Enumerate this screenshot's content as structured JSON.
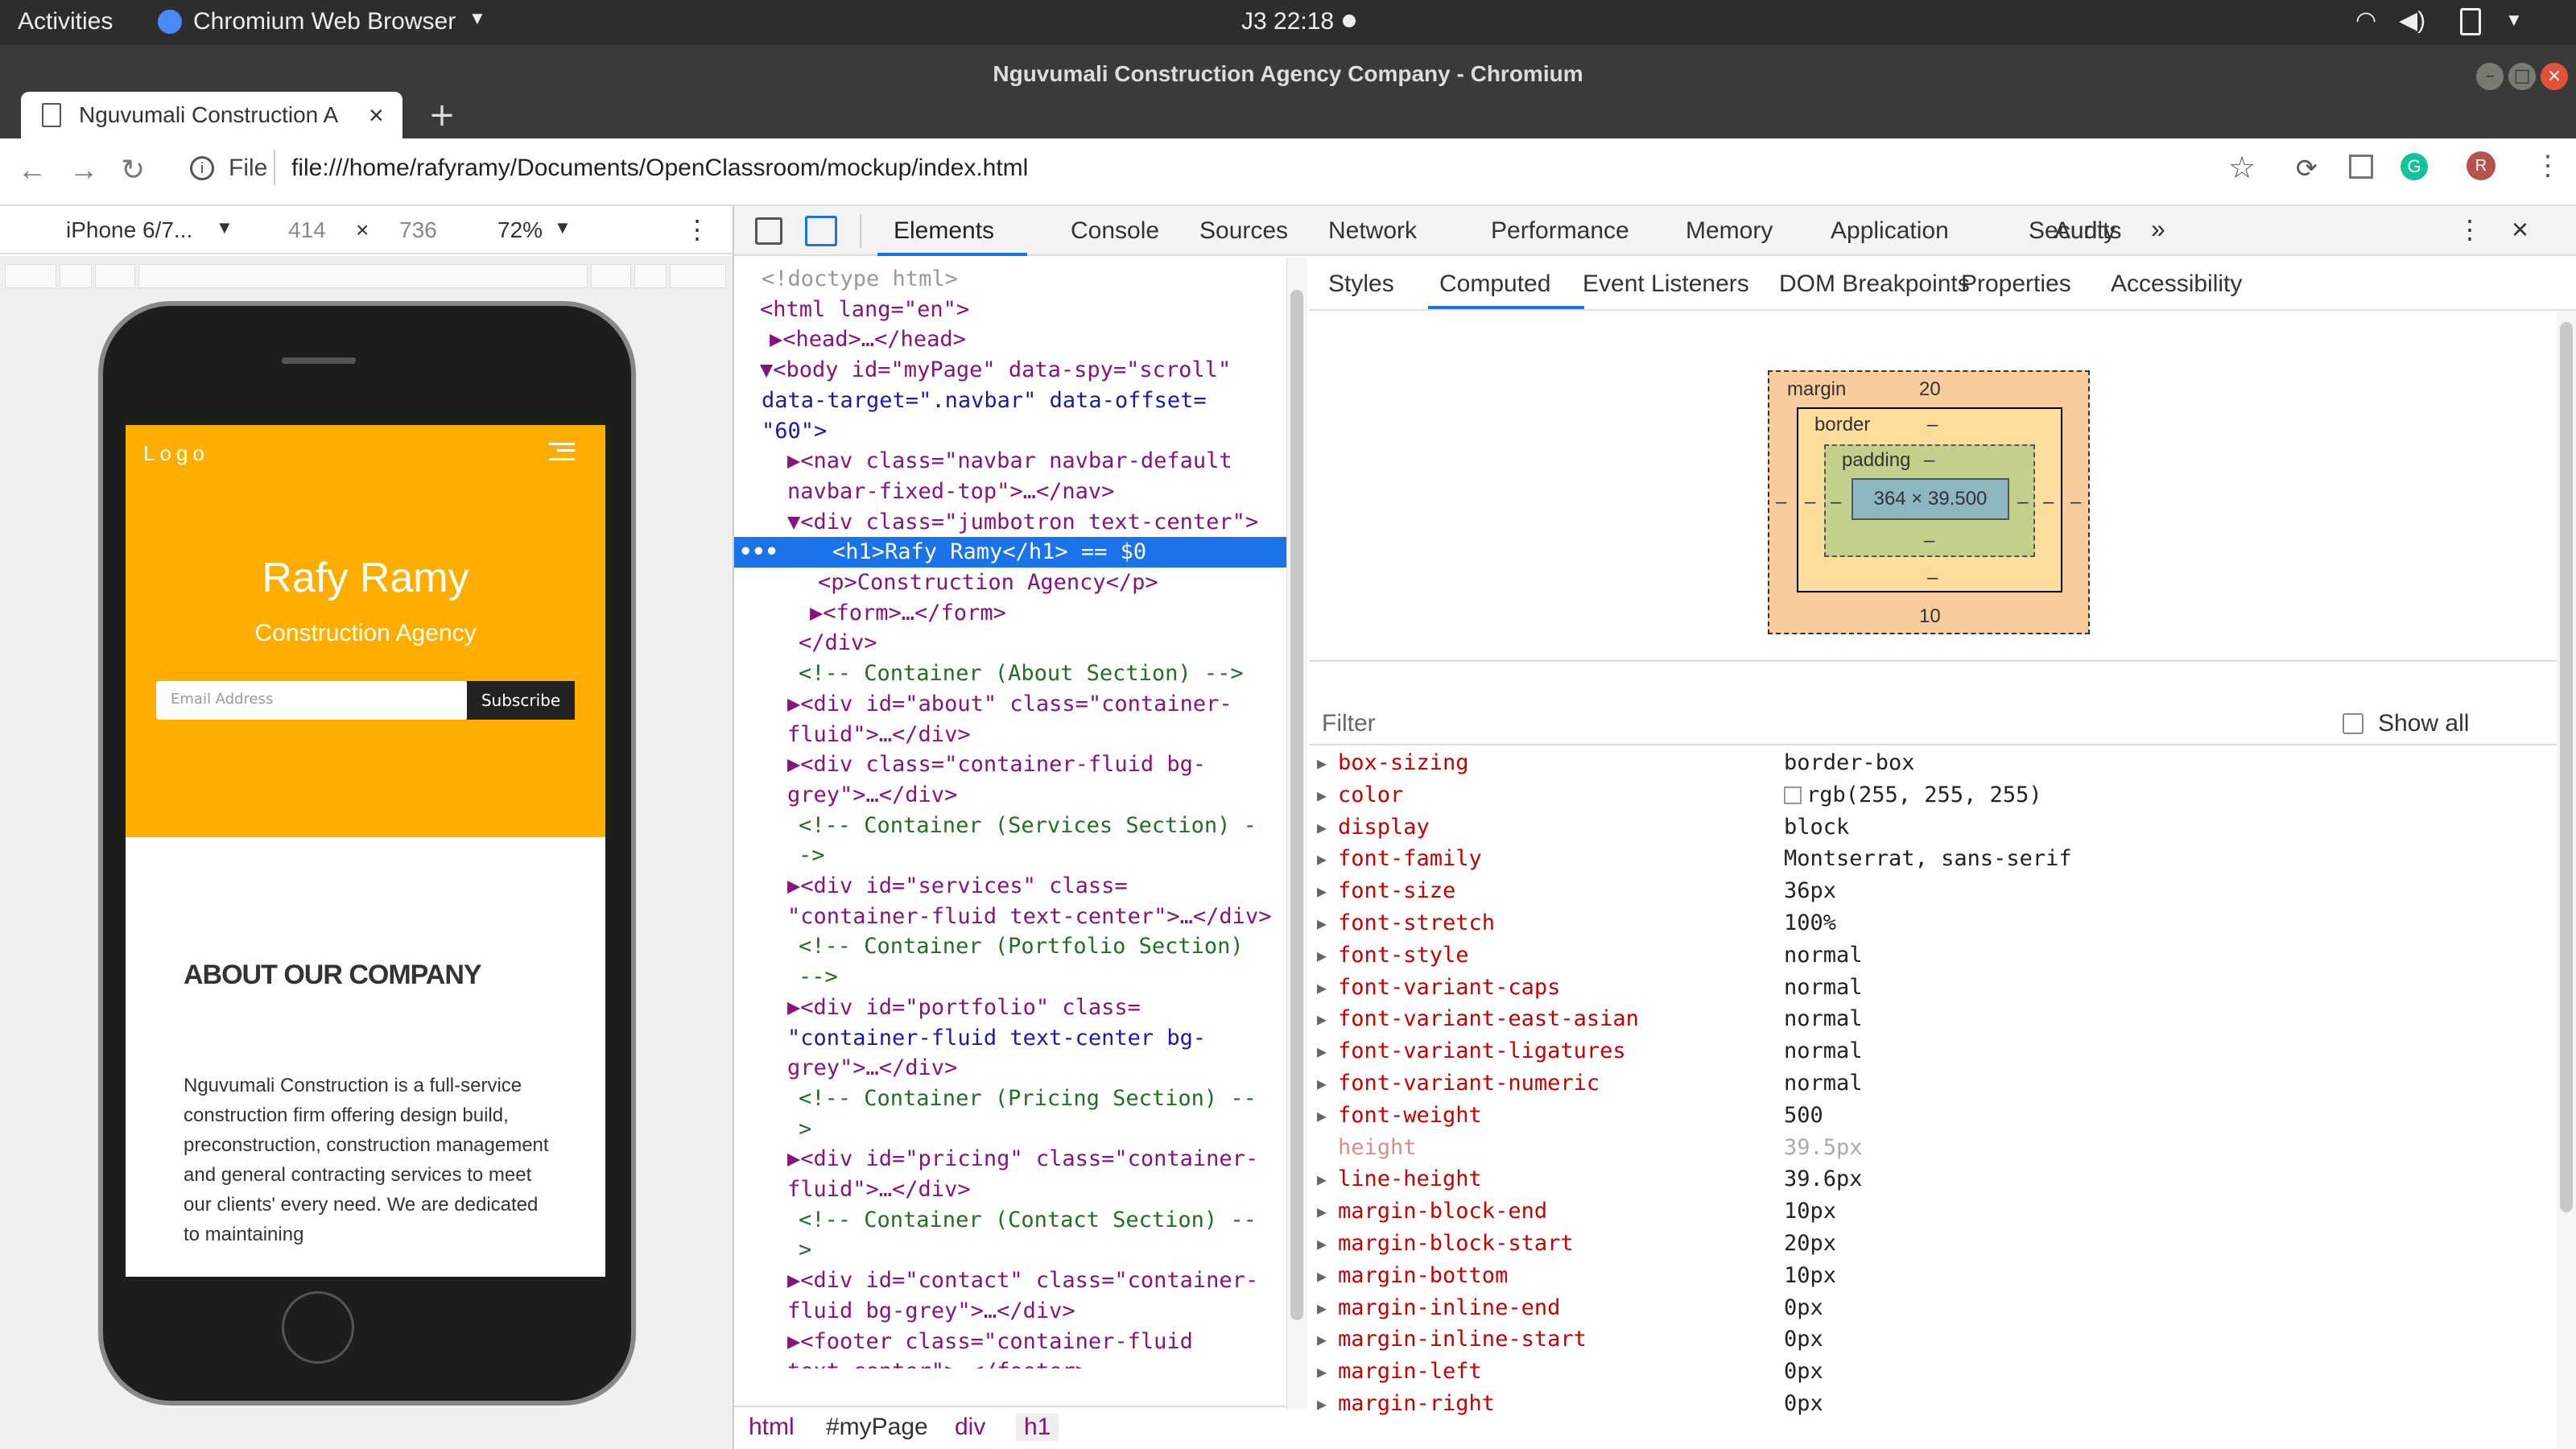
{
  "topbar": {
    "activities": "Activities",
    "app_name": "Chromium Web Browser",
    "clock": "J3 22:18"
  },
  "window": {
    "title": "Nguvumali Construction Agency Company - Chromium"
  },
  "tab": {
    "label": "Nguvumali Construction A"
  },
  "address": {
    "scheme_label": "File",
    "url": "file:///home/rafyramy/Documents/OpenClassroom/mockup/index.html",
    "profile_initial": "R"
  },
  "device_toolbar": {
    "device": "iPhone 6/7...",
    "width": "414",
    "times": "×",
    "height": "736",
    "zoom": "72%"
  },
  "site": {
    "logo": "Logo",
    "heading": "Rafy Ramy",
    "subheading": "Construction Agency",
    "email_placeholder": "Email Address",
    "subscribe": "Subscribe",
    "about_title": "ABOUT OUR COMPANY",
    "about_text": "Nguvumali Construction is a full-service construction firm offering design build, preconstruction, construction management and general contracting services to meet our clients' every need. We are dedicated to maintaining"
  },
  "devtools": {
    "tabs": [
      "Elements",
      "Console",
      "Sources",
      "Network",
      "Performance",
      "Memory",
      "Application",
      "Security",
      "Audits"
    ],
    "more": "»",
    "subtabs": [
      "Styles",
      "Computed",
      "Event Listeners",
      "DOM Breakpoints",
      "Properties",
      "Accessibility"
    ],
    "breadcrumb": [
      "html",
      "#myPage",
      "div",
      "h1"
    ],
    "filter_placeholder": "Filter",
    "show_all": "Show all",
    "box_model": {
      "margin_label": "margin",
      "margin_top": "20",
      "margin_bottom": "10",
      "border_label": "border",
      "border_val": "–",
      "padding_label": "padding",
      "padding_val": "–",
      "content": "364 × 39.500",
      "dash": "–"
    },
    "elements": [
      "<!doctype html>",
      "<html lang=\"en\">",
      "▶<head>…</head>",
      "▼<body id=\"myPage\" data-spy=\"scroll\"",
      "data-target=\".navbar\" data-offset=",
      "\"60\">",
      "▶<nav class=\"navbar navbar-default",
      "navbar-fixed-top\">…</nav>",
      "▼<div class=\"jumbotron text-center\">",
      "<h1>Rafy Ramy</h1> == $0",
      "<p>Construction Agency</p>",
      "▶<form>…</form>",
      "</div>",
      "<!-- Container (About Section) -->",
      "▶<div id=\"about\" class=\"container-",
      "fluid\">…</div>",
      "▶<div class=\"container-fluid bg-",
      "grey\">…</div>",
      "<!-- Container (Services Section) -",
      "->",
      "▶<div id=\"services\" class=",
      "\"container-fluid text-center\">…</div>",
      "<!-- Container (Portfolio Section)",
      "-->",
      "▶<div id=\"portfolio\" class=",
      "\"container-fluid text-center bg-",
      "grey\">…</div>",
      "<!-- Container (Pricing Section) --",
      ">",
      "▶<div id=\"pricing\" class=\"container-",
      "fluid\">…</div>",
      "<!-- Container (Contact Section) --",
      ">",
      "▶<div id=\"contact\" class=\"container-",
      "fluid bg-grey\">…</div>",
      "▶<footer class=\"container-fluid",
      "text-center\">…</footer>"
    ],
    "computed": [
      {
        "name": "box-sizing",
        "value": "border-box"
      },
      {
        "name": "color",
        "value": "rgb(255, 255, 255)"
      },
      {
        "name": "display",
        "value": "block"
      },
      {
        "name": "font-family",
        "value": "Montserrat, sans-serif"
      },
      {
        "name": "font-size",
        "value": "36px"
      },
      {
        "name": "font-stretch",
        "value": "100%"
      },
      {
        "name": "font-style",
        "value": "normal"
      },
      {
        "name": "font-variant-caps",
        "value": "normal"
      },
      {
        "name": "font-variant-east-asian",
        "value": "normal"
      },
      {
        "name": "font-variant-ligatures",
        "value": "normal"
      },
      {
        "name": "font-variant-numeric",
        "value": "normal"
      },
      {
        "name": "font-weight",
        "value": "500"
      },
      {
        "name": "height",
        "value": "39.5px"
      },
      {
        "name": "line-height",
        "value": "39.6px"
      },
      {
        "name": "margin-block-end",
        "value": "10px"
      },
      {
        "name": "margin-block-start",
        "value": "20px"
      },
      {
        "name": "margin-bottom",
        "value": "10px"
      },
      {
        "name": "margin-inline-end",
        "value": "0px"
      },
      {
        "name": "margin-inline-start",
        "value": "0px"
      },
      {
        "name": "margin-left",
        "value": "0px"
      },
      {
        "name": "margin-right",
        "value": "0px"
      }
    ]
  },
  "colors": {
    "hero": "#ffae00",
    "selection": "#1a73e8",
    "accent": "#1a73e8"
  }
}
